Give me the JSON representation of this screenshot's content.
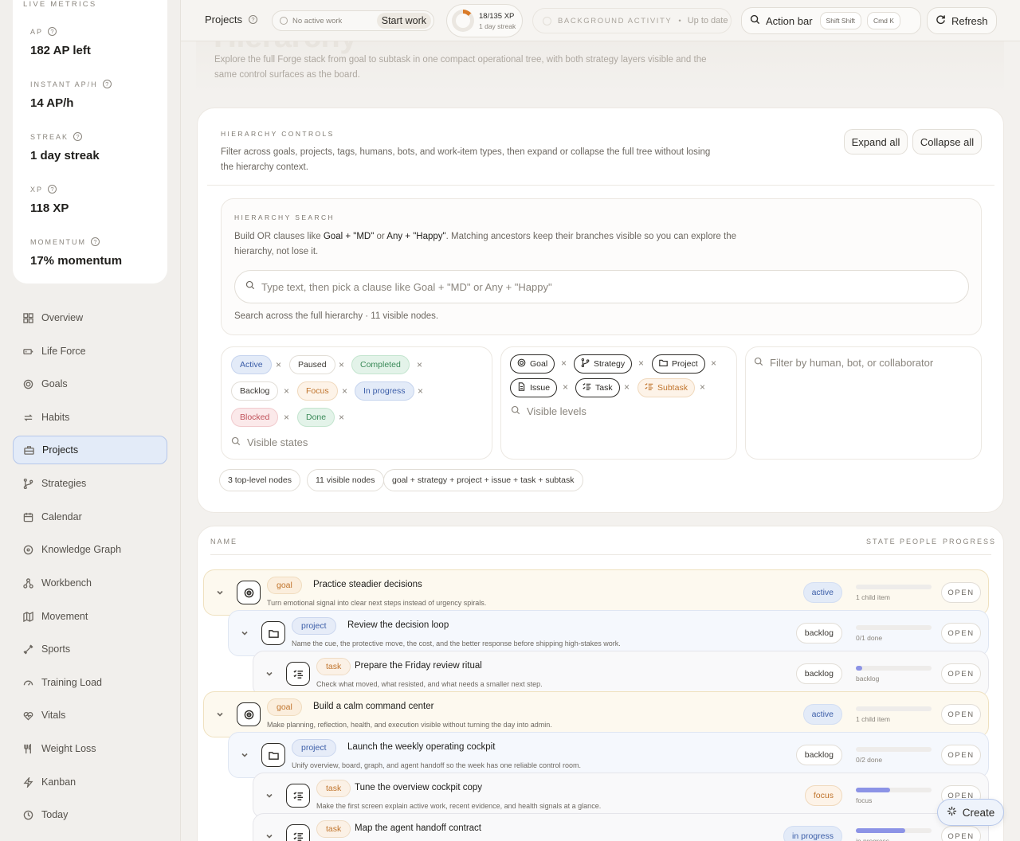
{
  "sidebar": {
    "metrics_title": "LIVE METRICS",
    "metrics": [
      {
        "label": "AP",
        "value": "182 AP left"
      },
      {
        "label": "INSTANT AP/H",
        "value": "14 AP/h"
      },
      {
        "label": "STREAK",
        "value": "1 day streak"
      },
      {
        "label": "XP",
        "value": "118 XP"
      },
      {
        "label": "MOMENTUM",
        "value": "17% momentum"
      }
    ],
    "nav": [
      {
        "label": "Overview",
        "icon": "grid-icon"
      },
      {
        "label": "Life Force",
        "icon": "battery-icon"
      },
      {
        "label": "Goals",
        "icon": "target-icon"
      },
      {
        "label": "Habits",
        "icon": "repeat-icon"
      },
      {
        "label": "Projects",
        "icon": "briefcase-icon"
      },
      {
        "label": "Strategies",
        "icon": "branch-icon"
      },
      {
        "label": "Calendar",
        "icon": "calendar-icon"
      },
      {
        "label": "Knowledge Graph",
        "icon": "graph-icon"
      },
      {
        "label": "Workbench",
        "icon": "workflow-icon"
      },
      {
        "label": "Movement",
        "icon": "map-icon"
      },
      {
        "label": "Sports",
        "icon": "dumbbell-icon"
      },
      {
        "label": "Training Load",
        "icon": "gauge-icon"
      },
      {
        "label": "Vitals",
        "icon": "heart-pulse-icon"
      },
      {
        "label": "Weight Loss",
        "icon": "utensils-icon"
      },
      {
        "label": "Kanban",
        "icon": "zap-icon"
      },
      {
        "label": "Today",
        "icon": "clock-icon"
      }
    ]
  },
  "topbar": {
    "projects": "Projects",
    "work_status": "No active work",
    "start_work": "Start work",
    "xp": "18/135 XP",
    "xp_sub": "1 day streak",
    "xp_progress": 0.133,
    "bg_label": "BACKGROUND ACTIVITY",
    "bg_status": "Up to date",
    "action_bar": "Action bar",
    "kbd1": "Shift Shift",
    "kbd2": "Cmd K",
    "refresh": "Refresh"
  },
  "header": {
    "title": "Hierarchy",
    "subtitle": "Explore the full Forge stack from goal to subtask in one compact operational tree, with both strategy layers visible and the same control surfaces as the board."
  },
  "controls": {
    "label": "HIERARCHY CONTROLS",
    "desc": "Filter across goals, projects, tags, humans, bots, and work-item types, then expand or collapse the full tree without losing the hierarchy context.",
    "expand_all": "Expand all",
    "collapse_all": "Collapse all",
    "search": {
      "label": "HIERARCHY SEARCH",
      "desc_1": "Build OR clauses like ",
      "desc_b1": "Goal + \"MD\"",
      "desc_2": " or ",
      "desc_b2": "Any + \"Happy\"",
      "desc_3": ". Matching ancestors keep their branches visible so you can explore the hierarchy, not lose it.",
      "placeholder": "Type text, then pick a clause like Goal + \"MD\" or Any + \"Happy\"",
      "status": "Search across the full hierarchy · 11 visible nodes."
    },
    "states": [
      "Active",
      "Paused",
      "Completed",
      "Backlog",
      "Focus",
      "In progress",
      "Blocked",
      "Done"
    ],
    "states_placeholder": "Visible states",
    "levels": [
      "Goal",
      "Strategy",
      "Project",
      "Issue",
      "Task",
      "Subtask"
    ],
    "levels_placeholder": "Visible levels",
    "people_placeholder": "Filter by human, bot, or collaborator",
    "summary": [
      "3 top-level nodes",
      "11 visible nodes",
      "goal + strategy + project + issue + task + subtask"
    ]
  },
  "tree": {
    "columns": {
      "name": "NAME",
      "state": "STATE",
      "people": "PEOPLE",
      "progress": "PROGRESS"
    },
    "open_label": "OPEN",
    "rows": [
      {
        "type": "goal",
        "title": "Practice steadier decisions",
        "desc": "Turn emotional signal into clear next steps instead of urgency spirals.",
        "state": "active",
        "progress_text": "1 child item",
        "progress": 0
      },
      {
        "type": "project",
        "title": "Review the decision loop",
        "desc": "Name the cue, the protective move, the cost, and the better response before shipping high-stakes work.",
        "state": "backlog",
        "progress_text": "0/1 done",
        "progress": 0
      },
      {
        "type": "task",
        "title": "Prepare the Friday review ritual",
        "desc": "Check what moved, what resisted, and what needs a smaller next step.",
        "state": "backlog",
        "progress_text": "backlog",
        "progress": 0.08
      },
      {
        "type": "goal",
        "title": "Build a calm command center",
        "desc": "Make planning, reflection, health, and execution visible without turning the day into admin.",
        "state": "active",
        "progress_text": "1 child item",
        "progress": 0
      },
      {
        "type": "project",
        "title": "Launch the weekly operating cockpit",
        "desc": "Unify overview, board, graph, and agent handoff so the week has one reliable control room.",
        "state": "backlog",
        "progress_text": "0/2 done",
        "progress": 0
      },
      {
        "type": "task",
        "title": "Tune the overview cockpit copy",
        "desc": "Make the first screen explain active work, recent evidence, and health signals at a glance.",
        "state": "focus",
        "progress_text": "focus",
        "progress": 0.45
      },
      {
        "type": "task",
        "title": "Map the agent handoff contract",
        "desc": "",
        "state": "in progress",
        "progress_text": "in progress",
        "progress": 0.65
      }
    ]
  },
  "create_label": "Create"
}
